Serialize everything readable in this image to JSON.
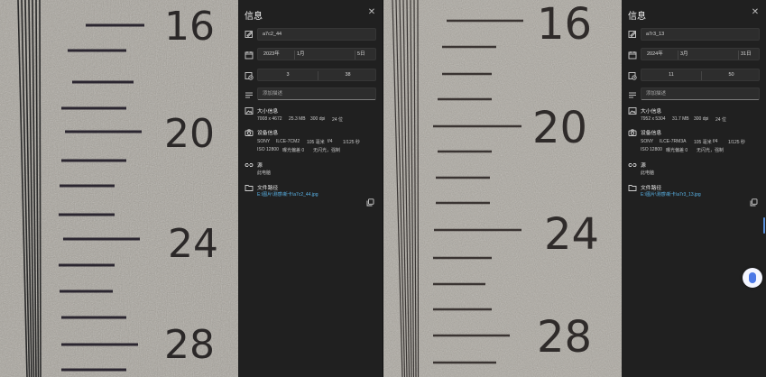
{
  "left": {
    "scale_labels": [
      "16",
      "20",
      "24",
      "28"
    ],
    "panel": {
      "title": "信息",
      "filename": "a7c2_44",
      "date": {
        "year": "2023年",
        "month": "1月",
        "day": "5日"
      },
      "time": {
        "hour": "3",
        "minute": "38"
      },
      "description_placeholder": "添加描述",
      "size_title": "大小信息",
      "size_values": [
        "7008 x 4672",
        "25.3 MB",
        "300 dpi",
        "24 位"
      ],
      "device_title": "设备信息",
      "device_line1": [
        "SONY",
        "ILCE-7CM2",
        "105 毫米",
        "f/4",
        "1/125 秒"
      ],
      "device_line2": [
        "ISO 12800",
        "曝光偏差 0",
        "无闪光，强制"
      ],
      "source_title": "源",
      "source_value": "此电脑",
      "path_title": "文件路径",
      "path_value": "E:\\图片\\测感\\新卡\\a7c2_44.jpg"
    }
  },
  "right": {
    "scale_labels": [
      "16",
      "20",
      "24",
      "28"
    ],
    "panel": {
      "title": "信息",
      "filename": "a7r3_13",
      "date": {
        "year": "2024年",
        "month": "3月",
        "day": "31日"
      },
      "time": {
        "hour": "11",
        "minute": "50"
      },
      "description_placeholder": "添加描述",
      "size_title": "大小信息",
      "size_values": [
        "7952 x 5304",
        "31.7 MB",
        "300 dpi",
        "24 位"
      ],
      "device_title": "设备信息",
      "device_line1": [
        "SONY",
        "ILCE-7RM3A",
        "105 毫米",
        "f/4",
        "1/125 秒"
      ],
      "device_line2": [
        "ISO 12800",
        "曝光偏差 0",
        "无闪光，强制"
      ],
      "source_title": "源",
      "source_value": "此电脑",
      "path_title": "文件路径",
      "path_value": "E:\\图片\\测感\\新卡\\a7r3_13.jpg"
    }
  },
  "icons": {
    "close": "close-icon",
    "rename": "rename-icon",
    "calendar": "calendar-icon",
    "clock": "clock-icon",
    "description": "description-icon",
    "size": "image-size-icon",
    "camera": "camera-icon",
    "source": "link-icon",
    "folder": "folder-icon",
    "copy": "copy-icon"
  },
  "colors": {
    "panel_bg": "#202020",
    "link": "#5ab4e8",
    "accent": "#4b78e6"
  }
}
